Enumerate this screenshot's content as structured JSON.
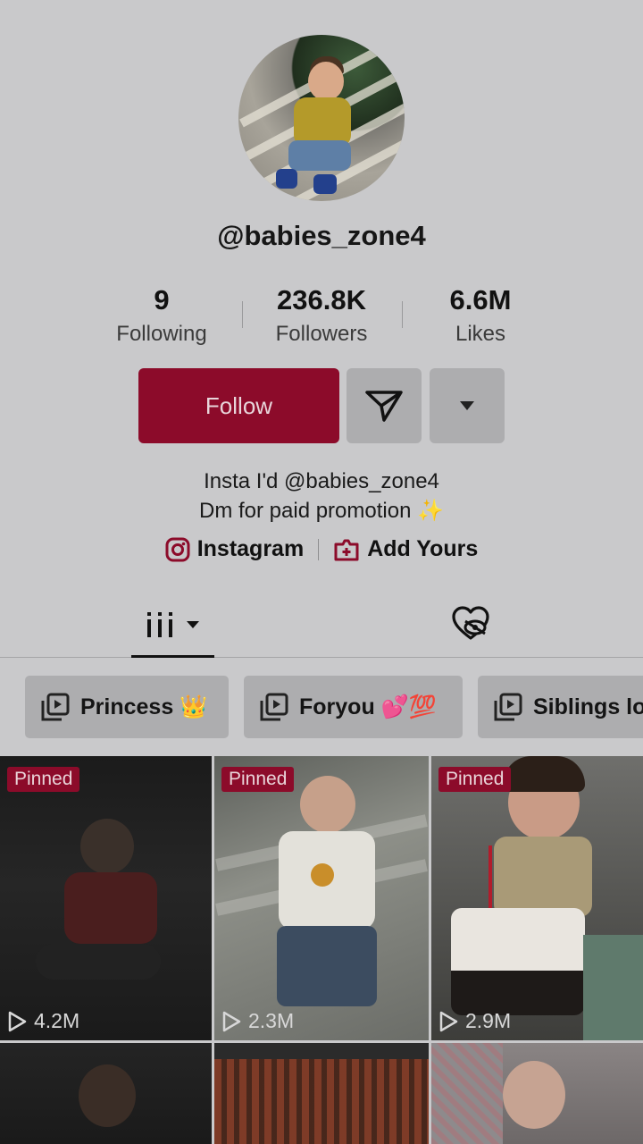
{
  "profile": {
    "username": "@babies_zone4"
  },
  "stats": [
    {
      "value": "9",
      "label": "Following"
    },
    {
      "value": "236.8K",
      "label": "Followers"
    },
    {
      "value": "6.6M",
      "label": "Likes"
    }
  ],
  "actions": {
    "follow_label": "Follow",
    "message_icon": "send-icon",
    "more_icon": "caret-down-icon"
  },
  "bio": {
    "line1": "Insta I'd @babies_zone4",
    "line2": "Dm for paid promotion ✨"
  },
  "links": {
    "instagram": "Instagram",
    "add_yours": "Add Yours"
  },
  "playlists": [
    {
      "label": "Princess 👑"
    },
    {
      "label": "Foryou 💕💯"
    },
    {
      "label": "Siblings lo"
    }
  ],
  "videos": [
    {
      "badge": "Pinned",
      "views": "4.2M"
    },
    {
      "badge": "Pinned",
      "views": "2.3M"
    },
    {
      "badge": "Pinned",
      "views": "2.9M"
    },
    {
      "badge": "",
      "views": ""
    },
    {
      "badge": "",
      "views": ""
    },
    {
      "badge": "",
      "views": ""
    }
  ],
  "colors": {
    "accent": "#8c0b2a",
    "background": "#c9c9cb",
    "button_gray": "#adadaf"
  }
}
